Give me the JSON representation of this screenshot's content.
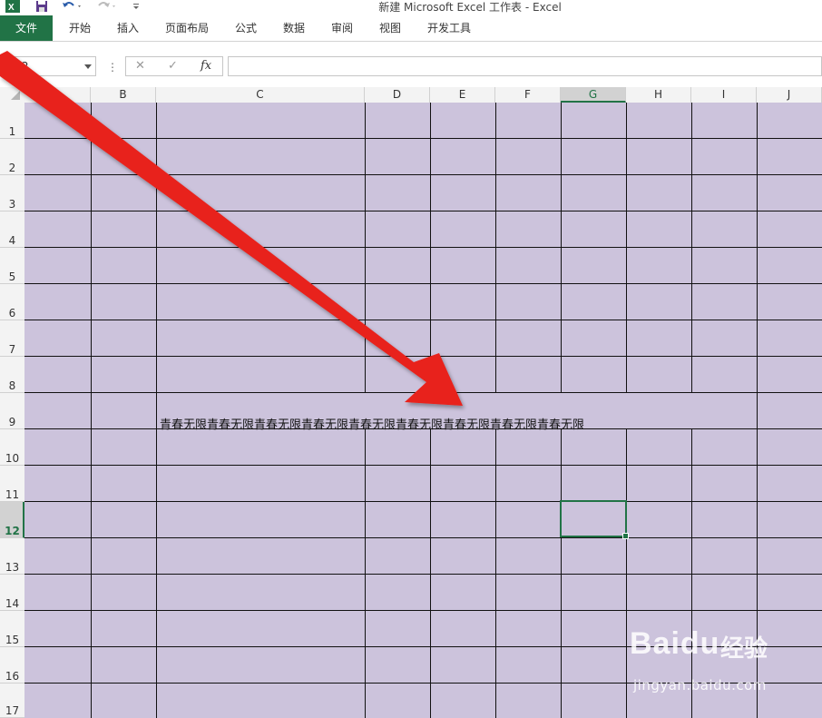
{
  "title": "新建 Microsoft Excel 工作表 - Excel",
  "ribbon": {
    "tabs": [
      "文件",
      "开始",
      "插入",
      "页面布局",
      "公式",
      "数据",
      "审阅",
      "视图",
      "开发工具"
    ]
  },
  "formula_bar": {
    "name_box": "G12",
    "fx_label": "fx",
    "cancel": "✕",
    "enter": "✓",
    "more": "⋮",
    "content": ""
  },
  "columns": [
    "A",
    "B",
    "C",
    "D",
    "E",
    "F",
    "G",
    "H",
    "I",
    "J"
  ],
  "rows": [
    "1",
    "2",
    "3",
    "4",
    "5",
    "6",
    "7",
    "8",
    "9",
    "10",
    "11",
    "12",
    "13",
    "14",
    "15",
    "16",
    "17"
  ],
  "selected_cell": "G12",
  "cells": {
    "C9": "青春无限青春无限青春无限青春无限青春无限青春无限青春无限青春无限青春无限"
  },
  "watermark": {
    "brand": "Baidu",
    "product": "经验",
    "url": "jingyan.baidu.com"
  },
  "colors": {
    "sheet_fill": "#ccc3dc",
    "excel_green": "#217346",
    "arrow": "#e8201a"
  },
  "icons": [
    "excel-app-icon",
    "save-icon",
    "undo-icon",
    "redo-icon",
    "customize-qat-icon",
    "annotation-arrow"
  ]
}
